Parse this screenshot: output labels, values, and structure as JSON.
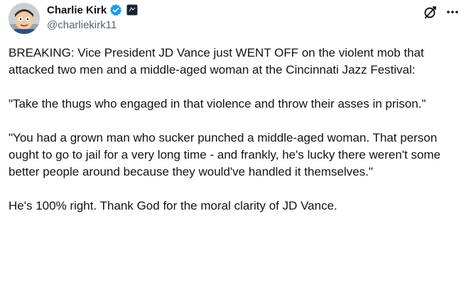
{
  "author": {
    "name": "Charlie Kirk",
    "handle": "@charliekirk11"
  },
  "icons": {
    "verified": "verified-badge-icon",
    "affiliation": "affiliation-badge-icon",
    "grok": "grok-icon",
    "more": "more-icon"
  },
  "colors": {
    "verified": "#1d9bf0",
    "text": "#0f1419",
    "secondary": "#536471"
  },
  "tweet": {
    "paragraphs": [
      "BREAKING: Vice President JD Vance just WENT OFF on the violent mob that attacked two men and a middle-aged woman at the Cincinnati Jazz Festival:",
      "\"Take the thugs who engaged in that violence and throw their asses in prison.\"",
      "\"You had a grown man who sucker punched a middle-aged woman. That person ought to go to jail for a very long time - and frankly, he's lucky there weren't some better people around because they would've handled it themselves.\"",
      "He's 100% right. Thank God for the moral clarity of JD Vance."
    ]
  }
}
